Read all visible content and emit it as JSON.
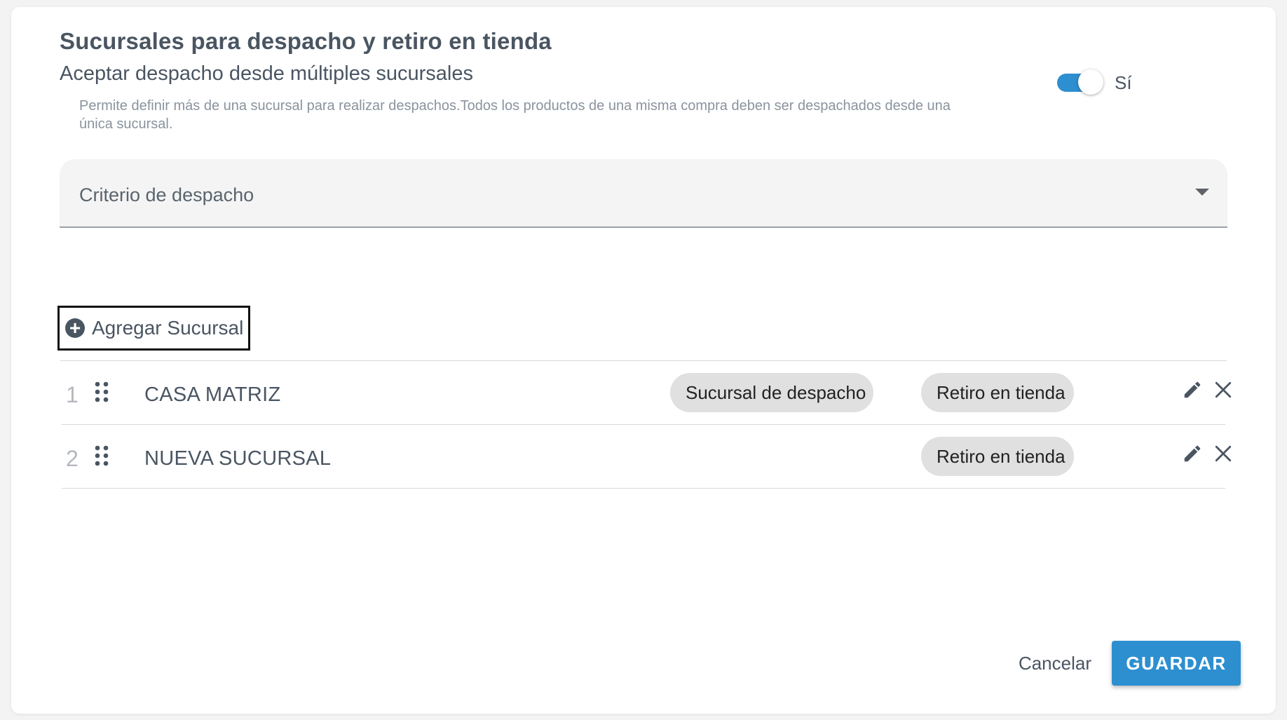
{
  "section": {
    "title": "Sucursales para despacho y retiro en tienda"
  },
  "multi_branch": {
    "label": "Aceptar despacho desde múltiples sucursales",
    "help": "Permite definir más de una sucursal para realizar despachos.Todos los productos de una misma compra deben ser despachados desde una única sucursal.",
    "toggle_on": true,
    "toggle_text": "Sí"
  },
  "criteria": {
    "label": "Criterio de despacho",
    "icon": "chevron-down-icon"
  },
  "actions": {
    "add_branch_label": "Agregar Sucursal",
    "add_icon": "add-circle-icon"
  },
  "branches": [
    {
      "index": "1",
      "name": "CASA MATRIZ",
      "chips": [
        "Sucursal de despacho",
        "Retiro en tienda"
      ]
    },
    {
      "index": "2",
      "name": "NUEVA SUCURSAL",
      "chips": [
        "Retiro en tienda"
      ]
    }
  ],
  "footer": {
    "cancel_label": "Cancelar",
    "save_label": "GUARDAR"
  },
  "colors": {
    "accent": "#2d8fd0",
    "text": "#4a5562",
    "chip_bg": "#e0e0e0"
  }
}
